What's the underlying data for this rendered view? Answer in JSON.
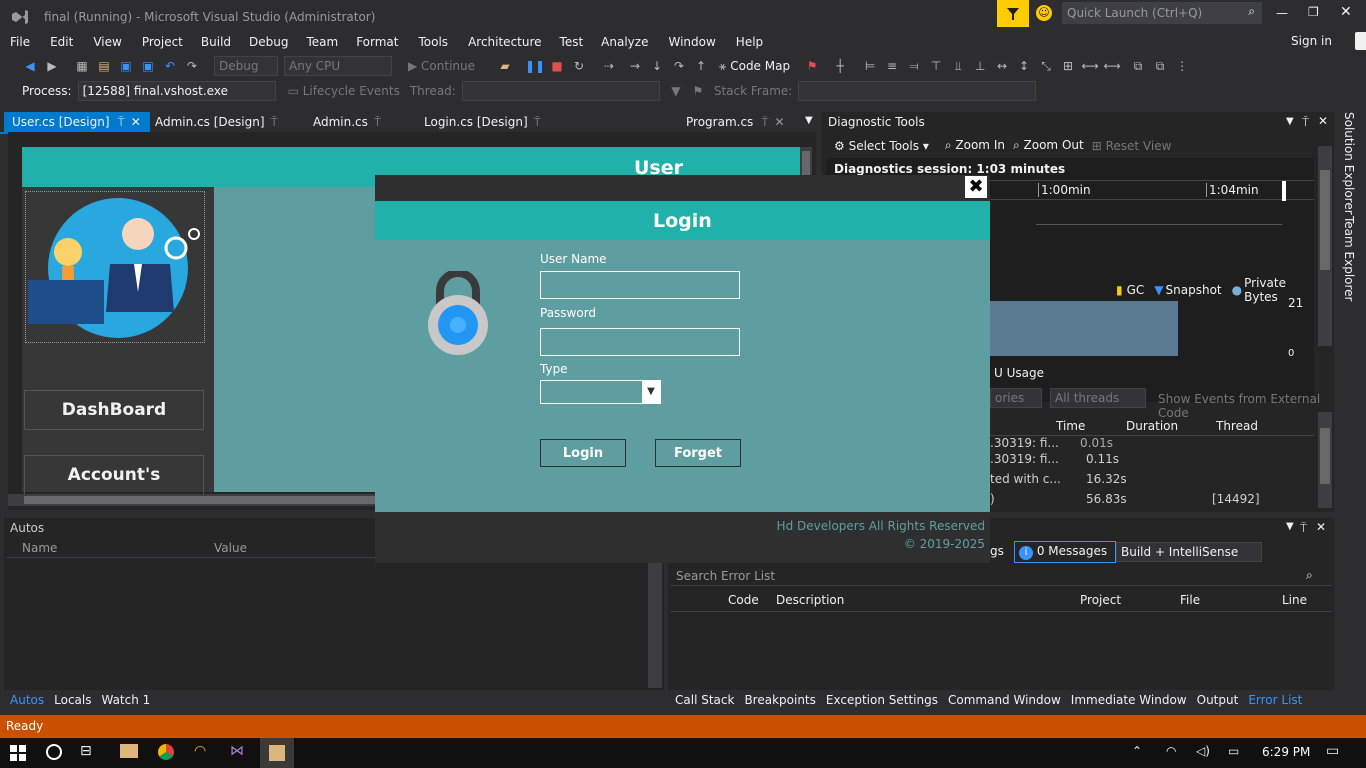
{
  "window": {
    "title": "final (Running) - Microsoft Visual Studio (Administrator)",
    "quick_launch_placeholder": "Quick Launch (Ctrl+Q)",
    "sign_in": "Sign in"
  },
  "menu": [
    "File",
    "Edit",
    "View",
    "Project",
    "Build",
    "Debug",
    "Team",
    "Format",
    "Tools",
    "Architecture",
    "Test",
    "Analyze",
    "Window",
    "Help"
  ],
  "toolbar": {
    "config": "Debug",
    "platform": "Any CPU",
    "continue": "Continue",
    "code_map": "Code Map"
  },
  "process_bar": {
    "process_label": "Process:",
    "process_value": "[12588] final.vshost.exe",
    "lifecycle": "Lifecycle Events",
    "thread_label": "Thread:",
    "stack_frame_label": "Stack Frame:"
  },
  "doc_tabs": [
    {
      "label": "User.cs [Design]"
    },
    {
      "label": "Admin.cs [Design]"
    },
    {
      "label": "Admin.cs"
    },
    {
      "label": "Login.cs [Design]"
    },
    {
      "label": "Program.cs"
    }
  ],
  "designer": {
    "header": "User",
    "btn1": "DashBoard",
    "btn2": "Account's"
  },
  "login_form": {
    "title": "Login",
    "username_label": "User Name",
    "password_label": "Password",
    "type_label": "Type",
    "login_button": "Login",
    "forget_button": "Forget",
    "footer1": "Hd Developers All Rights Reserved",
    "footer2": "© 2019-2025"
  },
  "diag": {
    "title": "Diagnostic Tools",
    "select_tools": "Select Tools",
    "zoom_in": "Zoom In",
    "zoom_out": "Zoom Out",
    "reset_view": "Reset View",
    "session": "Diagnostics session: 1:03 minutes",
    "t1": "1:00min",
    "t2": "1:04min",
    "legend_gc": "GC",
    "legend_snapshot": "Snapshot",
    "legend_private": "Private Bytes",
    "max_val": "21",
    "zero_val": "0",
    "cpu_usage": "U Usage",
    "cats": "ories",
    "all_threads": "All threads",
    "show_events": "Show Events from External Code",
    "cols": [
      "Time",
      "Duration",
      "Thread"
    ],
    "rows": [
      {
        "name": ".30319: fi...",
        "time": "0.01s",
        "thread": ""
      },
      {
        "name": ".30319: fi...",
        "time": "0.11s",
        "thread": ""
      },
      {
        "name": "ted with c...",
        "time": "16.32s",
        "thread": ""
      },
      {
        "name": ")",
        "time": "56.83s",
        "thread": "[14492]"
      }
    ]
  },
  "side_tabs": [
    "Solution Explorer",
    "Team Explorer"
  ],
  "autos": {
    "title": "Autos",
    "col_name": "Name",
    "col_value": "Value"
  },
  "error_list": {
    "warnings_partial": "gs",
    "messages": "0 Messages",
    "filter": "Build + IntelliSense",
    "search_placeholder": "Search Error List",
    "cols": [
      "Code",
      "Description",
      "Project",
      "File",
      "Line"
    ]
  },
  "bottom_tabs_left": [
    "Autos",
    "Locals",
    "Watch 1"
  ],
  "bottom_tabs_right": [
    "Call Stack",
    "Breakpoints",
    "Exception Settings",
    "Command Window",
    "Immediate Window",
    "Output",
    "Error List"
  ],
  "status": "Ready",
  "clock": "6:29 PM",
  "colors": {
    "accent": "#ca5100",
    "teal": "#20b2aa",
    "form_bg": "#5f9ea0",
    "vs_purple": "#68217a"
  }
}
